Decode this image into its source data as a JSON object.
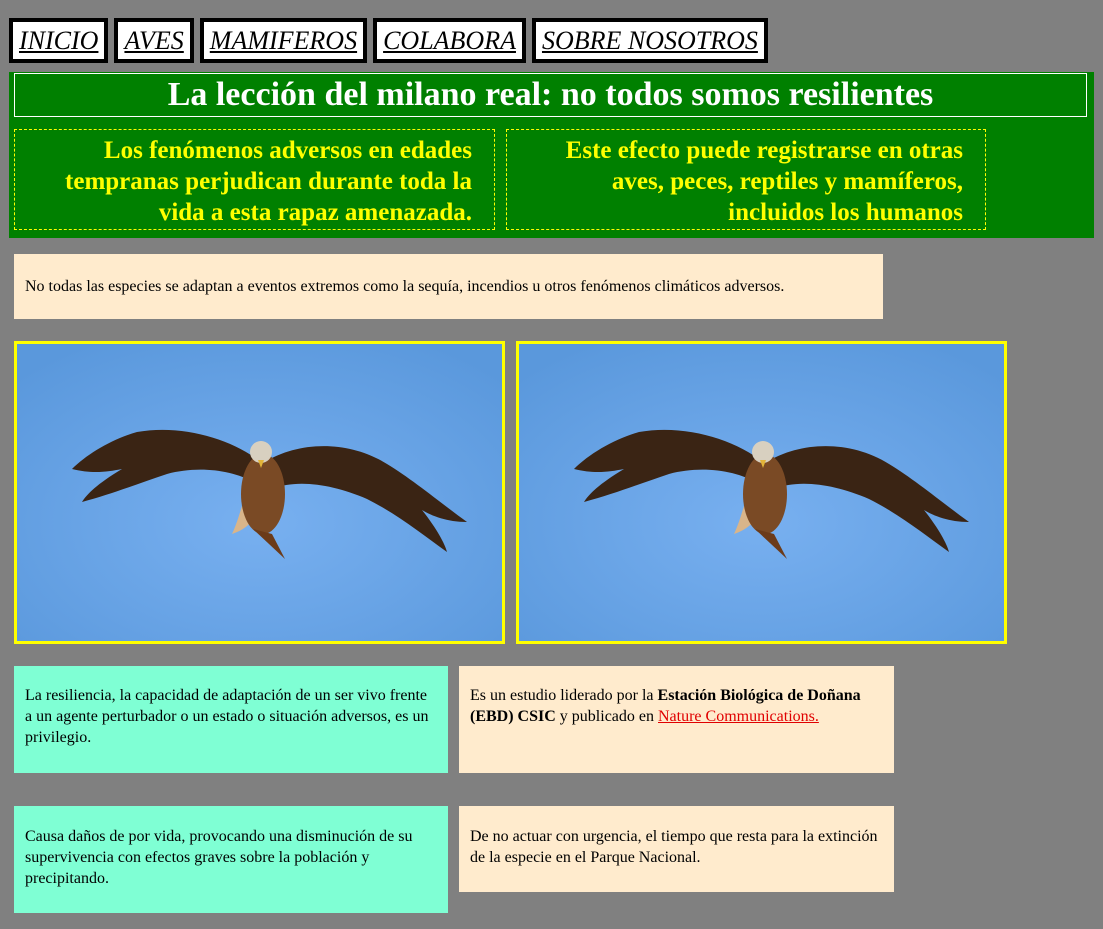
{
  "nav": {
    "items": [
      {
        "label": "INICIO"
      },
      {
        "label": "AVES"
      },
      {
        "label": "MAMIFEROS"
      },
      {
        "label": "COLABORA"
      },
      {
        "label": "SOBRE NOSOTROS"
      }
    ]
  },
  "banner": {
    "title": "La lección del milano real: no todos somos resilientes",
    "subtitle_left": "Los fenómenos adversos en edades tempranas perjudican durante toda la vida a esta rapaz amenazada.",
    "subtitle_right": "Este efecto puede registrarse en otras aves, peces, reptiles y mamíferos, incluidos los humanos"
  },
  "intro": "No todas las especies se adaptan a eventos extremos como la sequía, incendios u otros fenómenos climáticos adversos.",
  "images": [
    {
      "icon": "red-kite-photo"
    },
    {
      "icon": "red-kite-photo"
    }
  ],
  "cards": {
    "resilience": "La resiliencia, la capacidad de adaptación de un ser vivo frente a un agente perturbador o un estado o situación adversos, es un privilegio.",
    "study_prefix": "Es un estudio liderado por la ",
    "study_bold": "Estación Biológica de Doñana (EBD) CSIC",
    "study_middle": " y publicado en ",
    "study_link": "Nature Communications.",
    "damage": "Causa daños de por vida, provocando una disminución de su supervivencia con efectos graves sobre la población y precipitando.",
    "urgency": "De no actuar con urgencia, el tiempo que resta para la extinción de la especie en el Parque Nacional."
  },
  "colors": {
    "page_bg": "#808080",
    "banner_bg": "#008000",
    "subtitle": "#ffff00",
    "peach": "#ffebcd",
    "aqua": "#7fffd4",
    "link": "#e00000"
  }
}
